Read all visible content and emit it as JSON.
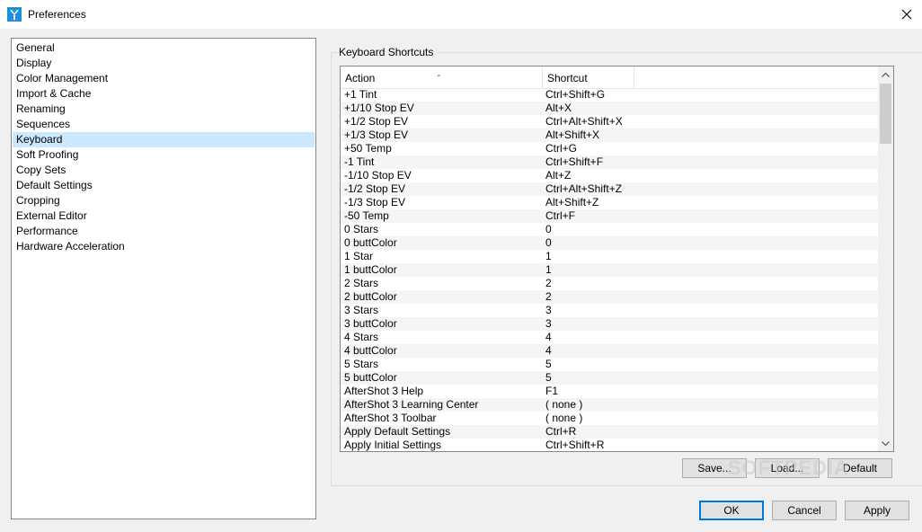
{
  "window": {
    "title": "Preferences"
  },
  "sidebar": {
    "items": [
      {
        "label": "General"
      },
      {
        "label": "Display"
      },
      {
        "label": "Color Management"
      },
      {
        "label": "Import & Cache"
      },
      {
        "label": "Renaming"
      },
      {
        "label": "Sequences"
      },
      {
        "label": "Keyboard"
      },
      {
        "label": "Soft Proofing"
      },
      {
        "label": "Copy Sets"
      },
      {
        "label": "Default Settings"
      },
      {
        "label": "Cropping"
      },
      {
        "label": "External Editor"
      },
      {
        "label": "Performance"
      },
      {
        "label": "Hardware Acceleration"
      }
    ],
    "selected": "Keyboard"
  },
  "shortcuts": {
    "group_title": "Keyboard Shortcuts",
    "columns": {
      "action": "Action",
      "shortcut": "Shortcut"
    },
    "rows": [
      [
        "+1 Tint",
        "Ctrl+Shift+G"
      ],
      [
        "+1/10 Stop EV",
        "Alt+X"
      ],
      [
        "+1/2 Stop EV",
        "Ctrl+Alt+Shift+X"
      ],
      [
        "+1/3 Stop EV",
        "Alt+Shift+X"
      ],
      [
        "+50 Temp",
        "Ctrl+G"
      ],
      [
        "-1 Tint",
        "Ctrl+Shift+F"
      ],
      [
        "-1/10 Stop EV",
        "Alt+Z"
      ],
      [
        "-1/2 Stop EV",
        "Ctrl+Alt+Shift+Z"
      ],
      [
        "-1/3 Stop EV",
        "Alt+Shift+Z"
      ],
      [
        "-50 Temp",
        "Ctrl+F"
      ],
      [
        "0 Stars",
        "0"
      ],
      [
        "0 buttColor",
        "0"
      ],
      [
        "1 Star",
        "1"
      ],
      [
        "1 buttColor",
        "1"
      ],
      [
        "2 Stars",
        "2"
      ],
      [
        "2 buttColor",
        "2"
      ],
      [
        "3 Stars",
        "3"
      ],
      [
        "3 buttColor",
        "3"
      ],
      [
        "4 Stars",
        "4"
      ],
      [
        "4 buttColor",
        "4"
      ],
      [
        "5 Stars",
        "5"
      ],
      [
        "5 buttColor",
        "5"
      ],
      [
        "AfterShot 3 Help",
        "F1"
      ],
      [
        "AfterShot 3 Learning Center",
        "( none )"
      ],
      [
        "AfterShot 3 Toolbar",
        "( none )"
      ],
      [
        "Apply Default Settings",
        "Ctrl+R"
      ],
      [
        "Apply Initial Settings",
        "Ctrl+Shift+R"
      ]
    ],
    "buttons": {
      "save": "Save...",
      "load": "Load...",
      "default": "Default"
    }
  },
  "footer": {
    "ok": "OK",
    "cancel": "Cancel",
    "apply": "Apply"
  },
  "watermark": "SOFTPEDIA",
  "colors": {
    "selection": "#cce8ff",
    "accent": "#0078d7",
    "icon": "#1e90d8"
  }
}
